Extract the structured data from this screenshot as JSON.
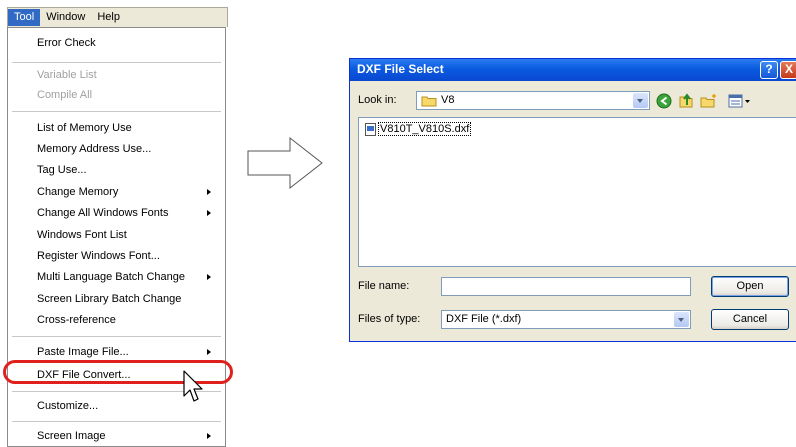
{
  "menubar": {
    "items": [
      "Tool",
      "Window",
      "Help"
    ]
  },
  "menu": {
    "items": [
      {
        "label": "Error Check",
        "disabled": false,
        "submenu": false
      },
      {
        "label": "Variable List",
        "disabled": true,
        "submenu": false
      },
      {
        "label": "Compile All",
        "disabled": true,
        "submenu": false
      },
      {
        "label": "List of Memory Use",
        "disabled": false,
        "submenu": false
      },
      {
        "label": "Memory Address Use...",
        "disabled": false,
        "submenu": false
      },
      {
        "label": "Tag Use...",
        "disabled": false,
        "submenu": false
      },
      {
        "label": "Change Memory",
        "disabled": false,
        "submenu": true
      },
      {
        "label": "Change All Windows Fonts",
        "disabled": false,
        "submenu": true
      },
      {
        "label": "Windows Font List",
        "disabled": false,
        "submenu": false
      },
      {
        "label": "Register Windows Font...",
        "disabled": false,
        "submenu": false
      },
      {
        "label": "Multi Language Batch Change",
        "disabled": false,
        "submenu": true
      },
      {
        "label": "Screen Library Batch Change",
        "disabled": false,
        "submenu": false
      },
      {
        "label": "Cross-reference",
        "disabled": false,
        "submenu": false
      },
      {
        "label": "Paste Image File...",
        "disabled": false,
        "submenu": true
      },
      {
        "label": "DXF File Convert...",
        "disabled": false,
        "submenu": false
      },
      {
        "label": "Customize...",
        "disabled": false,
        "submenu": false
      },
      {
        "label": "Screen Image",
        "disabled": false,
        "submenu": true
      }
    ],
    "highlighted": "DXF File Convert..."
  },
  "dialog": {
    "title": "DXF File Select",
    "help_label": "?",
    "close_label": "X",
    "look_in_label": "Look in:",
    "look_in_value": "V8",
    "files": [
      "V810T_V810S.dxf"
    ],
    "file_name_label": "File name:",
    "file_name_value": "",
    "files_of_type_label": "Files of type:",
    "files_of_type_value": "DXF File (*.dxf)",
    "open_label": "Open",
    "cancel_label": "Cancel"
  },
  "colors": {
    "highlight_ring": "#e0201c",
    "titlebar": "#0a5ae0",
    "menu_active": "#316ac5"
  }
}
